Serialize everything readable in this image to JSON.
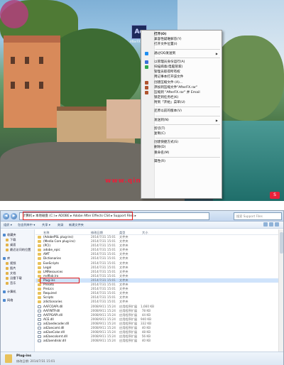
{
  "desktop": {
    "watermark": "www.qinginchong.com",
    "watermark_logo": "S",
    "app_icon": {
      "glyph": "Ae",
      "label": "AfterFX"
    }
  },
  "context_menu": {
    "items": [
      {
        "label": "打开(O)",
        "bold": true,
        "icon": "",
        "arrow": false
      },
      {
        "label": "兼容性疑难解答(Y)",
        "icon": "",
        "arrow": false
      },
      {
        "label": "打开文件位置(I)",
        "icon": "",
        "arrow": false,
        "sep_after": true
      },
      {
        "label": "通过QQ发送到",
        "icon": "qq-icon",
        "arrow": true,
        "sep_after": true
      },
      {
        "label": "以管理员身份运行(A)",
        "icon": "shield-icon",
        "arrow": false
      },
      {
        "label": "扫描病毒(电脑管家)",
        "icon": "scan-icon",
        "arrow": false
      },
      {
        "label": "管理员取得所有权",
        "icon": "",
        "arrow": false
      },
      {
        "label": "用记事本打开该文件",
        "icon": "",
        "arrow": false
      },
      {
        "label": "创建压缩文件 (A)...",
        "icon": "archive-icon",
        "arrow": false
      },
      {
        "label": "添加到压缩文件\"AfterFX.rar\"",
        "icon": "archive-icon",
        "arrow": false
      },
      {
        "label": "压缩到 \"AfterFX.rar\" 并 Email",
        "icon": "archive-icon",
        "arrow": false
      },
      {
        "label": "锁定到任务栏(K)",
        "icon": "",
        "arrow": false
      },
      {
        "label": "附到「开始」菜单(U)",
        "icon": "",
        "arrow": false,
        "sep_after": true
      },
      {
        "label": "还原以前的版本(V)",
        "icon": "",
        "arrow": false,
        "sep_after": true
      },
      {
        "label": "发送到(N)",
        "icon": "",
        "arrow": true,
        "sep_after": true
      },
      {
        "label": "剪切(T)",
        "icon": "",
        "arrow": false
      },
      {
        "label": "复制(C)",
        "icon": "",
        "arrow": false,
        "sep_after": true
      },
      {
        "label": "创建快捷方式(S)",
        "icon": "",
        "arrow": false
      },
      {
        "label": "删除(D)",
        "icon": "",
        "arrow": false
      },
      {
        "label": "重命名(M)",
        "icon": "",
        "arrow": false,
        "sep_after": true
      },
      {
        "label": "属性(R)",
        "icon": "",
        "arrow": false
      }
    ]
  },
  "explorer": {
    "address": "计算机 ▸ 本地磁盘 (C:) ▸ ADOBE ▸ Adobe After Effects CS4 ▸ Support Files ▸",
    "search_placeholder": "搜索 Support Files",
    "toolbar": [
      "组织 ▾",
      "包含到库中 ▾",
      "共享 ▾",
      "刻录",
      "新建文件夹"
    ],
    "columns": [
      "名称",
      "修改日期",
      "类型",
      "大小"
    ],
    "nav": [
      {
        "label": "收藏夹",
        "sub": false
      },
      {
        "label": "下载",
        "sub": true
      },
      {
        "label": "桌面",
        "sub": true
      },
      {
        "label": "最近访问的位置",
        "sub": true
      },
      {
        "gap": true
      },
      {
        "label": "库",
        "sub": false
      },
      {
        "label": "视频",
        "sub": true
      },
      {
        "label": "图片",
        "sub": true
      },
      {
        "label": "文档",
        "sub": true
      },
      {
        "label": "迅雷下载",
        "sub": true
      },
      {
        "label": "音乐",
        "sub": true
      },
      {
        "gap": true
      },
      {
        "label": "计算机",
        "sub": false
      },
      {
        "gap": true
      },
      {
        "label": "网络",
        "sub": false
      }
    ],
    "rows": [
      {
        "name": "(AdobePSL plug-ins)",
        "date": "2014/7/31 15:01",
        "type": "文件夹",
        "size": "",
        "file": false
      },
      {
        "name": "(Media Core plug-ins)",
        "date": "2014/7/31 15:01",
        "type": "文件夹",
        "size": "",
        "file": false
      },
      {
        "name": "(PCI)",
        "date": "2014/7/31 15:01",
        "type": "文件夹",
        "size": "",
        "file": false
      },
      {
        "name": "adobe_epic",
        "date": "2014/7/31 15:01",
        "type": "文件夹",
        "size": "",
        "file": false
      },
      {
        "name": "AMT",
        "date": "2014/7/31 15:01",
        "type": "文件夹",
        "size": "",
        "file": false
      },
      {
        "name": "Dictionaries",
        "date": "2014/7/31 15:01",
        "type": "文件夹",
        "size": "",
        "file": false
      },
      {
        "name": "ExeScripts",
        "date": "2014/7/31 15:01",
        "type": "文件夹",
        "size": "",
        "file": false
      },
      {
        "name": "Legal",
        "date": "2014/7/31 15:01",
        "type": "文件夹",
        "size": "",
        "file": false
      },
      {
        "name": "LMResources",
        "date": "2014/7/31 15:01",
        "type": "文件夹",
        "size": "",
        "file": false
      },
      {
        "name": "mdflob.lro",
        "date": "2014/7/31 15:01",
        "type": "文件夹",
        "size": "",
        "file": false
      },
      {
        "name": "Plug-ins",
        "date": "2014/7/31 15:01",
        "type": "文件夹",
        "size": "",
        "file": false,
        "selected": true
      },
      {
        "name": "Presets",
        "date": "2014/7/31 15:01",
        "type": "文件夹",
        "size": "",
        "file": false
      },
      {
        "name": "PreLics",
        "date": "2014/7/31 15:01",
        "type": "文件夹",
        "size": "",
        "file": false
      },
      {
        "name": "Required",
        "date": "2014/7/31 15:01",
        "type": "文件夹",
        "size": "",
        "file": false
      },
      {
        "name": "Scripts",
        "date": "2014/7/31 15:01",
        "type": "文件夹",
        "size": "",
        "file": false
      },
      {
        "name": "zdictionaries",
        "date": "2014/7/31 15:01",
        "type": "文件夹",
        "size": "",
        "file": false
      },
      {
        "name": "AAFCOAPI.dll",
        "date": "2008/9/11 15:24",
        "type": "应用程序扩展",
        "size": "1,660 KB",
        "file": true
      },
      {
        "name": "AAFINTP.dll",
        "date": "2008/9/11 15:24",
        "type": "应用程序扩展",
        "size": "78 KB",
        "file": true
      },
      {
        "name": "AAFPGAPI.dll",
        "date": "2008/9/11 15:24",
        "type": "应用程序扩展",
        "size": "44 KB",
        "file": true
      },
      {
        "name": "ACE.dll",
        "date": "2008/9/11 15:24",
        "type": "应用程序扩展",
        "size": "940 KB",
        "file": true
      },
      {
        "name": "ad2aedecoder.dll",
        "date": "2008/9/11 15:24",
        "type": "应用程序扩展",
        "size": "332 KB",
        "file": true
      },
      {
        "name": "ad2aecaml.dll",
        "date": "2008/9/11 15:24",
        "type": "应用程序扩展",
        "size": "40 KB",
        "file": true
      },
      {
        "name": "ad2aeColor.dll",
        "date": "2008/9/11 15:24",
        "type": "应用程序扩展",
        "size": "48 KB",
        "file": true
      },
      {
        "name": "ad2aecolornt.dll",
        "date": "2008/9/11 15:24",
        "type": "应用程序扩展",
        "size": "56 KB",
        "file": true
      },
      {
        "name": "ad2aendiskr.dll",
        "date": "2008/9/11 15:24",
        "type": "应用程序扩展",
        "size": "40 KB",
        "file": true
      }
    ],
    "status": {
      "name": "Plug-ins",
      "meta": "修改日期: 2014/7/31 15:01",
      "type": "文件夹"
    }
  }
}
